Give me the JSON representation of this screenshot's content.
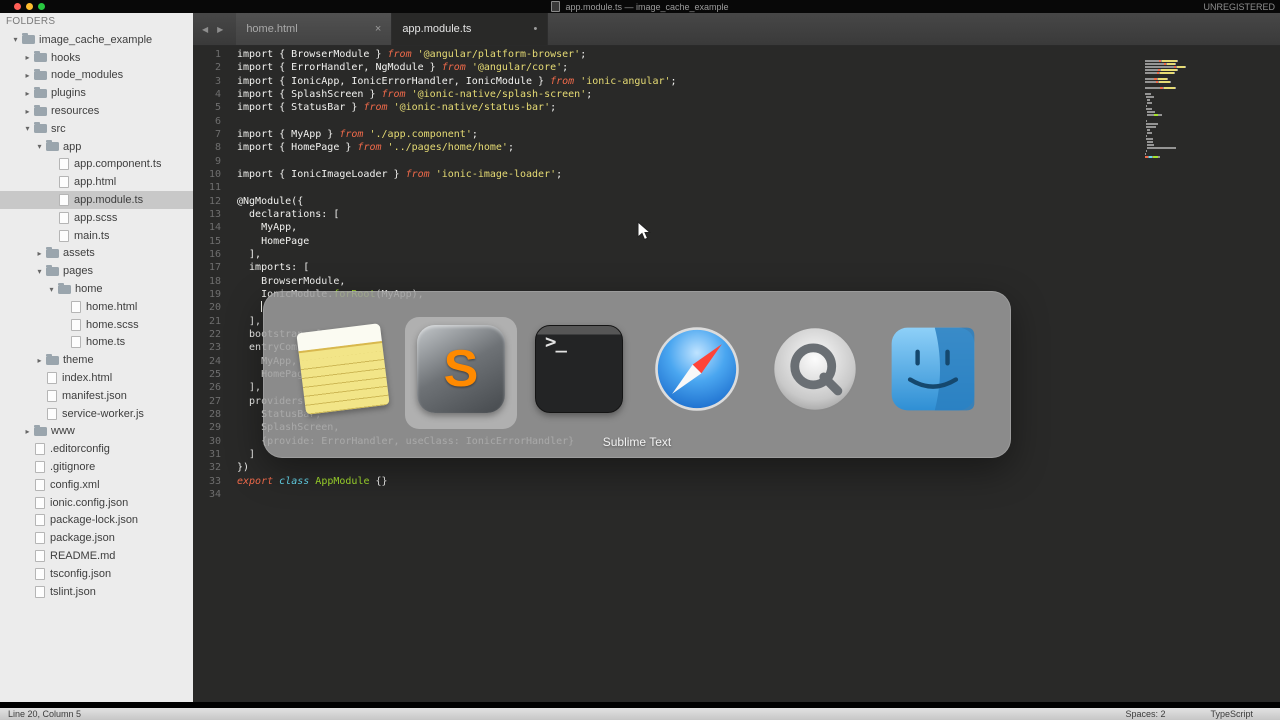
{
  "titlebar": {
    "title": "app.module.ts — image_cache_example",
    "registration": "UNREGISTERED"
  },
  "sidebar": {
    "header": "FOLDERS",
    "items": [
      {
        "label": "image_cache_example",
        "kind": "folder",
        "state": "expanded",
        "depth": 0
      },
      {
        "label": "hooks",
        "kind": "folder",
        "state": "collapsed",
        "depth": 1
      },
      {
        "label": "node_modules",
        "kind": "folder",
        "state": "collapsed",
        "depth": 1
      },
      {
        "label": "plugins",
        "kind": "folder",
        "state": "collapsed",
        "depth": 1
      },
      {
        "label": "resources",
        "kind": "folder",
        "state": "collapsed",
        "depth": 1
      },
      {
        "label": "src",
        "kind": "folder",
        "state": "expanded",
        "depth": 1
      },
      {
        "label": "app",
        "kind": "folder",
        "state": "expanded",
        "depth": 2
      },
      {
        "label": "app.component.ts",
        "kind": "file",
        "depth": 3
      },
      {
        "label": "app.html",
        "kind": "file",
        "depth": 3
      },
      {
        "label": "app.module.ts",
        "kind": "file",
        "depth": 3,
        "selected": true
      },
      {
        "label": "app.scss",
        "kind": "file",
        "depth": 3
      },
      {
        "label": "main.ts",
        "kind": "file",
        "depth": 3
      },
      {
        "label": "assets",
        "kind": "folder",
        "state": "collapsed",
        "depth": 2
      },
      {
        "label": "pages",
        "kind": "folder",
        "state": "expanded",
        "depth": 2
      },
      {
        "label": "home",
        "kind": "folder",
        "state": "expanded",
        "depth": 3
      },
      {
        "label": "home.html",
        "kind": "file",
        "depth": 4
      },
      {
        "label": "home.scss",
        "kind": "file",
        "depth": 4
      },
      {
        "label": "home.ts",
        "kind": "file",
        "depth": 4
      },
      {
        "label": "theme",
        "kind": "folder",
        "state": "collapsed",
        "depth": 2
      },
      {
        "label": "index.html",
        "kind": "file",
        "depth": 2
      },
      {
        "label": "manifest.json",
        "kind": "file",
        "depth": 2
      },
      {
        "label": "service-worker.js",
        "kind": "file",
        "depth": 2
      },
      {
        "label": "www",
        "kind": "folder",
        "state": "collapsed",
        "depth": 1
      },
      {
        "label": ".editorconfig",
        "kind": "file",
        "depth": 1
      },
      {
        "label": ".gitignore",
        "kind": "file",
        "depth": 1
      },
      {
        "label": "config.xml",
        "kind": "file",
        "depth": 1
      },
      {
        "label": "ionic.config.json",
        "kind": "file",
        "depth": 1
      },
      {
        "label": "package-lock.json",
        "kind": "file",
        "depth": 1
      },
      {
        "label": "package.json",
        "kind": "file",
        "depth": 1
      },
      {
        "label": "README.md",
        "kind": "file",
        "depth": 1
      },
      {
        "label": "tsconfig.json",
        "kind": "file",
        "depth": 1
      },
      {
        "label": "tslint.json",
        "kind": "file",
        "depth": 1
      }
    ]
  },
  "tabbar": {
    "nav_back": "◀",
    "nav_forward": "▶",
    "tabs": [
      {
        "label": "home.html",
        "indicator": "×",
        "active": false
      },
      {
        "label": "app.module.ts",
        "indicator": "•",
        "active": true
      }
    ]
  },
  "editor": {
    "cursor_line": 20,
    "lines": [
      [
        [
          "p",
          "import { BrowserModule } "
        ],
        [
          "k",
          "from"
        ],
        [
          "p",
          " "
        ],
        [
          "s",
          "'@angular/platform-browser'"
        ],
        [
          "p",
          ";"
        ]
      ],
      [
        [
          "p",
          "import { ErrorHandler, NgModule } "
        ],
        [
          "k",
          "from"
        ],
        [
          "p",
          " "
        ],
        [
          "s",
          "'@angular/core'"
        ],
        [
          "p",
          ";"
        ]
      ],
      [
        [
          "p",
          "import { IonicApp, IonicErrorHandler, IonicModule } "
        ],
        [
          "k",
          "from"
        ],
        [
          "p",
          " "
        ],
        [
          "s",
          "'ionic-angular'"
        ],
        [
          "p",
          ";"
        ]
      ],
      [
        [
          "p",
          "import { SplashScreen } "
        ],
        [
          "k",
          "from"
        ],
        [
          "p",
          " "
        ],
        [
          "s",
          "'@ionic-native/splash-screen'"
        ],
        [
          "p",
          ";"
        ]
      ],
      [
        [
          "p",
          "import { StatusBar } "
        ],
        [
          "k",
          "from"
        ],
        [
          "p",
          " "
        ],
        [
          "s",
          "'@ionic-native/status-bar'"
        ],
        [
          "p",
          ";"
        ]
      ],
      [],
      [
        [
          "p",
          "import { MyApp } "
        ],
        [
          "k",
          "from"
        ],
        [
          "p",
          " "
        ],
        [
          "s",
          "'./app.component'"
        ],
        [
          "p",
          ";"
        ]
      ],
      [
        [
          "p",
          "import { HomePage } "
        ],
        [
          "k",
          "from"
        ],
        [
          "p",
          " "
        ],
        [
          "s",
          "'../pages/home/home'"
        ],
        [
          "p",
          ";"
        ]
      ],
      [],
      [
        [
          "p",
          "import { IonicImageLoader } "
        ],
        [
          "k",
          "from"
        ],
        [
          "p",
          " "
        ],
        [
          "s",
          "'ionic-image-loader'"
        ],
        [
          "p",
          ";"
        ]
      ],
      [],
      [
        [
          "p",
          "@NgModule({"
        ]
      ],
      [
        [
          "p",
          "  declarations: ["
        ]
      ],
      [
        [
          "p",
          "    MyApp,"
        ]
      ],
      [
        [
          "p",
          "    HomePage"
        ]
      ],
      [
        [
          "p",
          "  ],"
        ]
      ],
      [
        [
          "p",
          "  imports: ["
        ]
      ],
      [
        [
          "p",
          "    BrowserModule,"
        ]
      ],
      [
        [
          "p",
          "    IonicModule."
        ],
        [
          "f",
          "forRoot"
        ],
        [
          "p",
          "(MyApp),"
        ]
      ],
      [
        [
          "p",
          "    "
        ]
      ],
      [
        [
          "p",
          "  ],"
        ]
      ],
      [
        [
          "p",
          "  bootstrap: [IonicApp],"
        ]
      ],
      [
        [
          "p",
          "  entryComponents: ["
        ]
      ],
      [
        [
          "p",
          "    MyApp,"
        ]
      ],
      [
        [
          "p",
          "    HomePage"
        ]
      ],
      [
        [
          "p",
          "  ],"
        ]
      ],
      [
        [
          "p",
          "  providers: ["
        ]
      ],
      [
        [
          "p",
          "    StatusBar,"
        ]
      ],
      [
        [
          "p",
          "    SplashScreen,"
        ]
      ],
      [
        [
          "p",
          "    {provide: ErrorHandler, useClass: IonicErrorHandler}"
        ]
      ],
      [
        [
          "p",
          "  ]"
        ]
      ],
      [
        [
          "p",
          "})"
        ]
      ],
      [
        [
          "k",
          "export"
        ],
        [
          "p",
          " "
        ],
        [
          "c",
          "class"
        ],
        [
          "p",
          " "
        ],
        [
          "f",
          "AppModule"
        ],
        [
          "p",
          " {}"
        ]
      ],
      []
    ]
  },
  "switcher": {
    "selected_app": "Sublime Text",
    "apps": [
      {
        "name": "Notes"
      },
      {
        "name": "Sublime Text",
        "glyph": "S",
        "selected": true
      },
      {
        "name": "Terminal",
        "glyph": ">_"
      },
      {
        "name": "Safari"
      },
      {
        "name": "QuickTime Player"
      },
      {
        "name": "Finder"
      }
    ]
  },
  "statusbar": {
    "position": "Line 20, Column 5",
    "indent": "Spaces: 2",
    "syntax": "TypeScript"
  }
}
